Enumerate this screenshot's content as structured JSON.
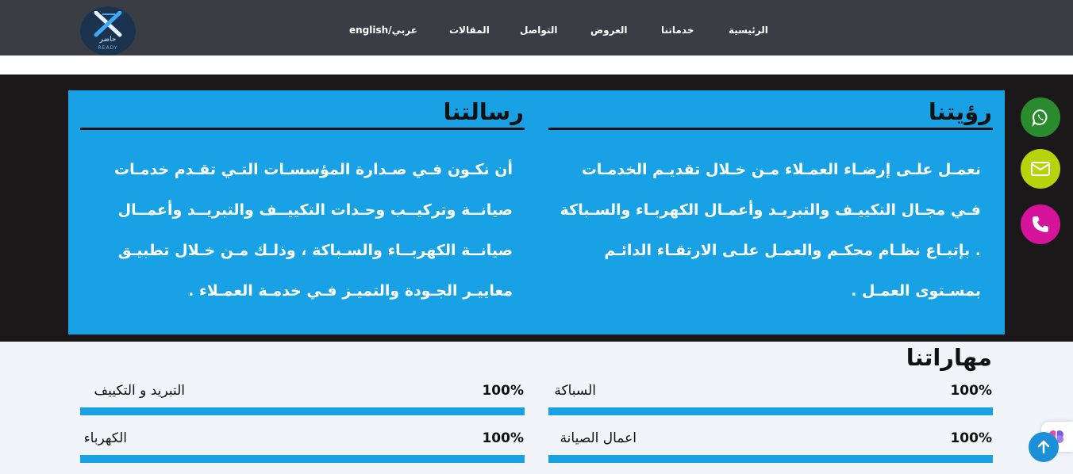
{
  "brand": {
    "arabic_name": "حاضر",
    "english_name": "READY"
  },
  "nav": {
    "items": [
      {
        "label": "الرئيسية"
      },
      {
        "label": "خدماتنا"
      },
      {
        "label": "العروض"
      },
      {
        "label": "التواصل"
      },
      {
        "label": "المقالات"
      },
      {
        "label": "english/عربي"
      }
    ]
  },
  "vision": {
    "title": "رؤيتنا",
    "lines": [
      "نعمـل علـى إرضـاء العمـلاء مـن خـلال تقديـم الخدمـات",
      "فـي مجـال التكييـف والتبريـد وأعمـال الكهربـاء والسـباكة",
      ". بإتبـاع نظـام محكـم والعمـل علـى الارتقـاء الدائـم",
      "بمسـتوى العمـل ."
    ]
  },
  "mission": {
    "title": "رسالتنا",
    "lines": [
      "أن نكـون فـي صـدارة المؤسسـات التـي تقـدم خدمـات",
      "صيانــة وتركيــب وحـدات التكييــف والتبريــد وأعمــال",
      "صيانــة الكهربــاء والسـباكة ، وذلـك مـن خـلال تطبيـق",
      "معاييـر الجـودة والتميـز فـي خدمـة العمـلاء ."
    ]
  },
  "social": {
    "whatsapp": {
      "icon": "whatsapp-icon",
      "color": "#2a8b2e"
    },
    "email": {
      "icon": "envelope-icon",
      "color": "#b5d40c"
    },
    "phone": {
      "icon": "phone-icon",
      "color": "#d6149b"
    }
  },
  "skills": {
    "title": "مهاراتنا",
    "items": [
      {
        "name": "السباكة",
        "percent_label": "100%",
        "value": 100
      },
      {
        "name": "التبريد و التكييف",
        "percent_label": "100%",
        "value": 100
      },
      {
        "name": "اعمال الصيانة",
        "percent_label": "100%",
        "value": 100
      },
      {
        "name": "الكهرباء",
        "percent_label": "100%",
        "value": 100
      }
    ]
  },
  "colors": {
    "nav_bg": "#3a3d44",
    "accent_blue": "#18a2e5",
    "dark_band": "#1b1819"
  }
}
